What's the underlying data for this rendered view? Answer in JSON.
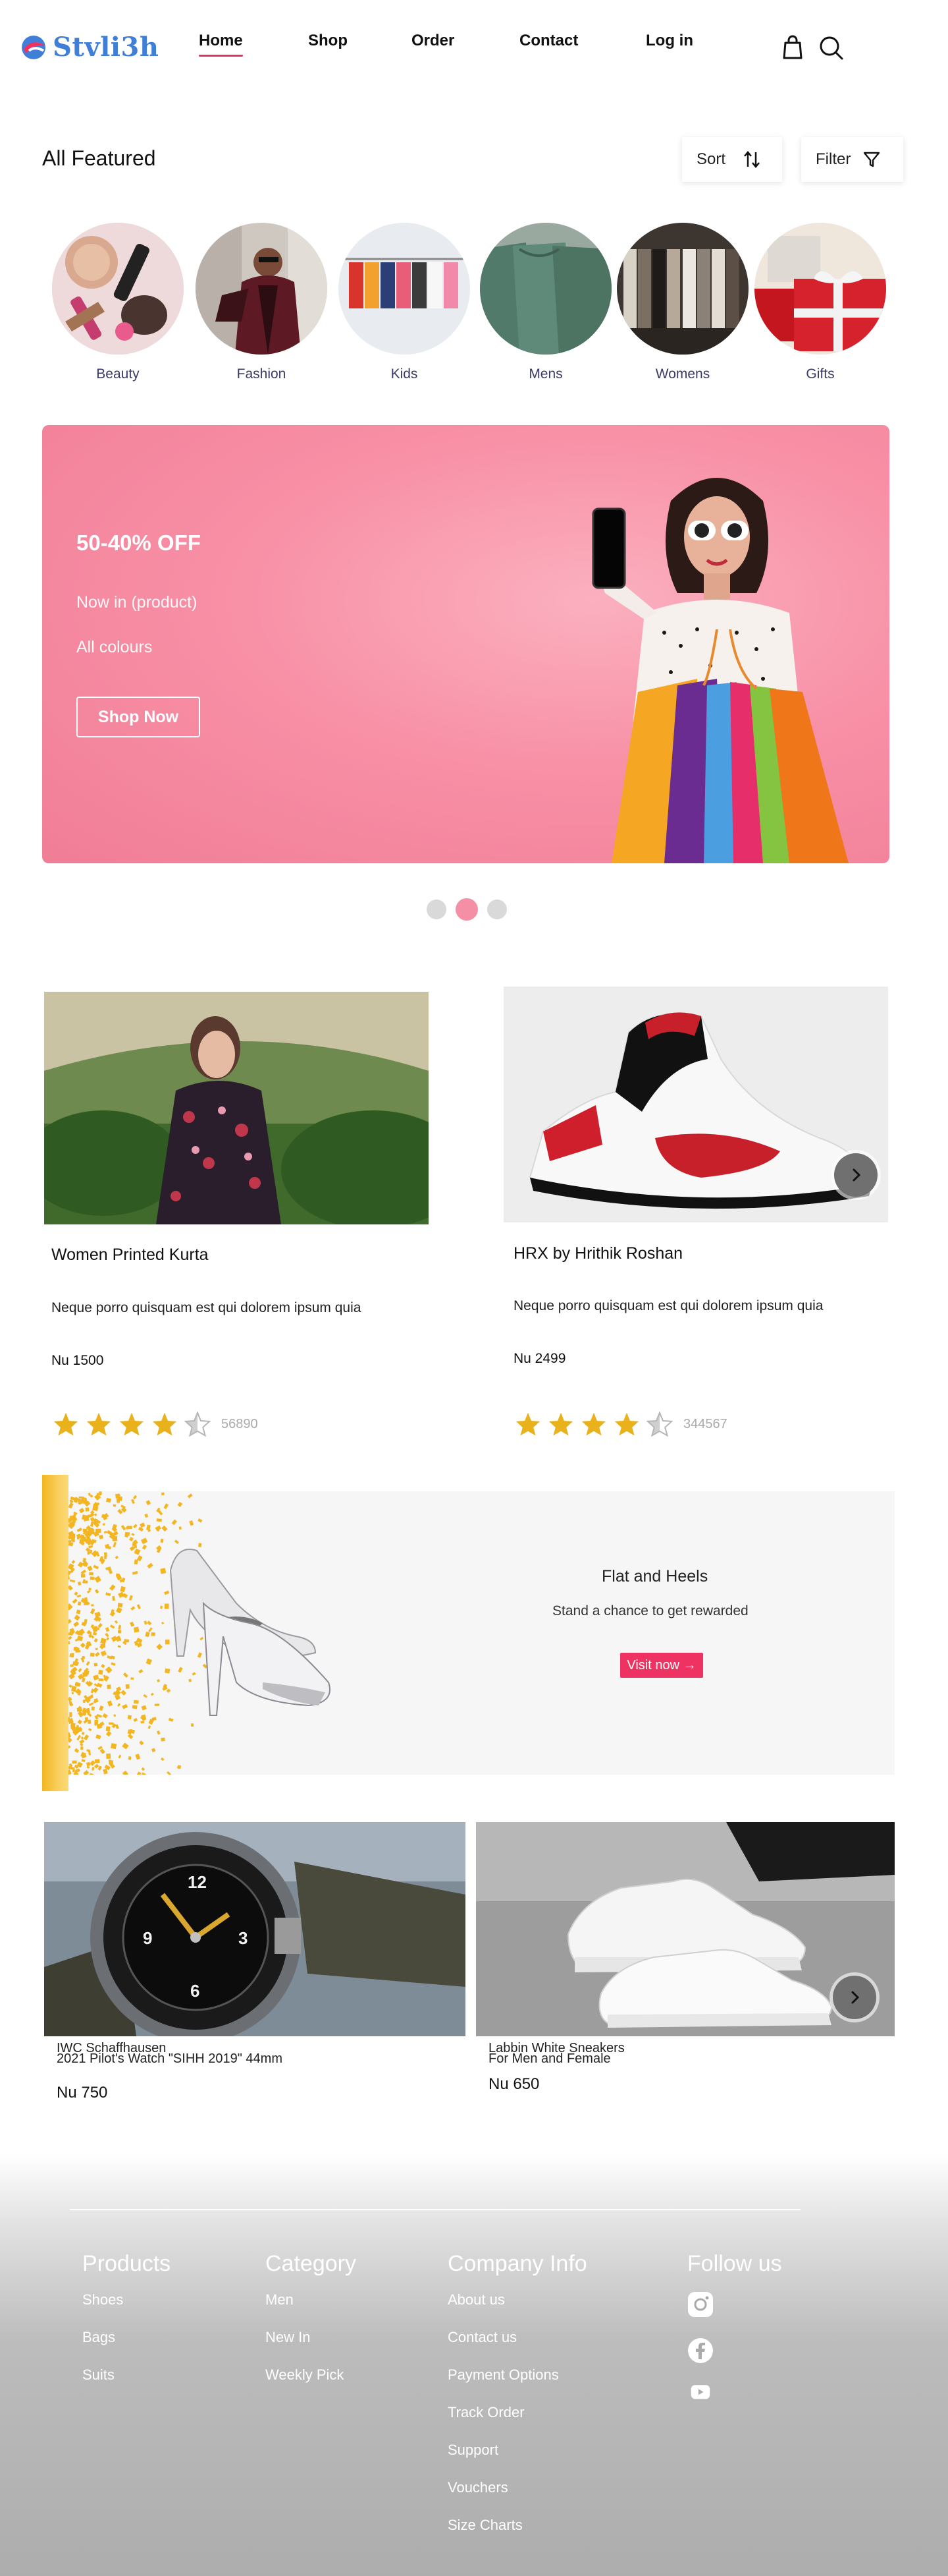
{
  "brand": {
    "name": "Stvli3h"
  },
  "nav": {
    "home": "Home",
    "shop": "Shop",
    "order": "Order",
    "contact": "Contact",
    "login": "Log in"
  },
  "header_icons": {
    "bag": "bag-icon",
    "search": "search-icon"
  },
  "featured": {
    "title": "All Featured",
    "sort_label": "Sort",
    "filter_label": "Filter",
    "categories": [
      {
        "label": "Beauty"
      },
      {
        "label": "Fashion"
      },
      {
        "label": "Kids"
      },
      {
        "label": "Mens"
      },
      {
        "label": "Womens"
      },
      {
        "label": "Gifts"
      }
    ]
  },
  "hero": {
    "offer": "50-40% OFF",
    "line1": "Now in (product)",
    "line2": "All colours",
    "button": "Shop Now",
    "active_slide": 2,
    "slides": 3
  },
  "products": [
    {
      "name": "Women Printed Kurta",
      "description": "Neque porro quisquam est qui dolorem ipsum quia",
      "price": "Nu 1500",
      "rating": 4.5,
      "reviews": "56890"
    },
    {
      "name": "HRX by Hrithik Roshan",
      "description": "Neque porro quisquam est qui dolorem ipsum quia",
      "price": "Nu 2499",
      "rating": 4.5,
      "reviews": "344567"
    }
  ],
  "promo": {
    "title": "Flat and Heels",
    "subtitle": "Stand a chance to get rewarded",
    "button": "Visit now →"
  },
  "bottom_products": [
    {
      "line1": "IWC Schaffhausen",
      "line2": "2021 Pilot's Watch \"SIHH 2019\" 44mm",
      "price": "Nu 750"
    },
    {
      "line1": "Labbin White Sneakers",
      "line2": "For Men and Female",
      "price": "Nu 650"
    }
  ],
  "footer": {
    "products": {
      "title": "Products",
      "links": [
        "Shoes",
        "Bags",
        "Suits"
      ]
    },
    "category": {
      "title": "Category",
      "links": [
        "Men",
        "New In",
        "Weekly Pick"
      ]
    },
    "company": {
      "title": "Company Info",
      "links": [
        "About us",
        "Contact us",
        "Payment Options",
        "Track Order",
        "Support",
        "Vouchers",
        "Size Charts"
      ]
    },
    "follow": {
      "title": "Follow us",
      "icons": [
        "instagram-icon",
        "facebook-icon",
        "youtube-icon"
      ]
    }
  },
  "colors": {
    "brand_blue": "#3f7fd8",
    "accent_pink": "#e0335f",
    "hero_pink": "#f890a6",
    "star_gold": "#e9b21d",
    "promo_yellow": "#f3b520"
  }
}
